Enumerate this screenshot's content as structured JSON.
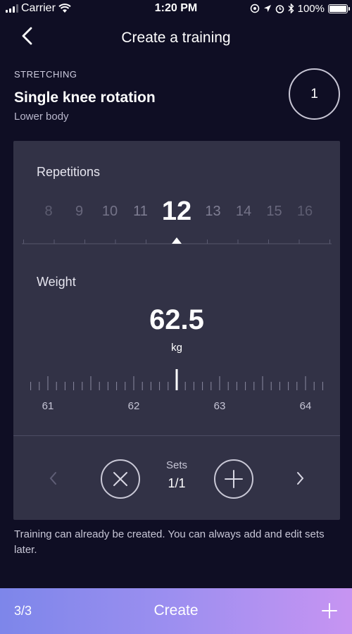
{
  "status_bar": {
    "carrier": "Carrier",
    "time": "1:20 PM",
    "battery": "100%",
    "battery_level": 1.0,
    "icons": [
      "signal-icon",
      "wifi-icon",
      "location-lock-icon",
      "location-icon",
      "alarm-icon",
      "bluetooth-icon",
      "battery-icon"
    ]
  },
  "nav": {
    "title": "Create a training",
    "back_icon": "chevron-left-icon"
  },
  "exercise": {
    "category": "STRETCHING",
    "name": "Single knee rotation",
    "body_part": "Lower body",
    "set_number": "1"
  },
  "repetitions": {
    "label": "Repetitions",
    "values": [
      "8",
      "9",
      "10",
      "11",
      "12",
      "13",
      "14",
      "15",
      "16"
    ],
    "selected": "12"
  },
  "weight": {
    "label": "Weight",
    "value": "62.5",
    "unit": "kg",
    "scale_labels": [
      "61",
      "62",
      "63",
      "64"
    ]
  },
  "sets": {
    "label": "Sets",
    "value": "1/1",
    "remove_icon": "close-circle-icon",
    "add_icon": "plus-circle-icon"
  },
  "hint": "Training can already be created. You can always add and edit sets later.",
  "footer": {
    "count": "3/3",
    "create_label": "Create",
    "plus_icon": "plus-icon"
  },
  "colors": {
    "background": "#0f0e24",
    "card": "#323246",
    "accent_gradient_start": "#7d86ea",
    "accent_gradient_end": "#c794f2"
  }
}
